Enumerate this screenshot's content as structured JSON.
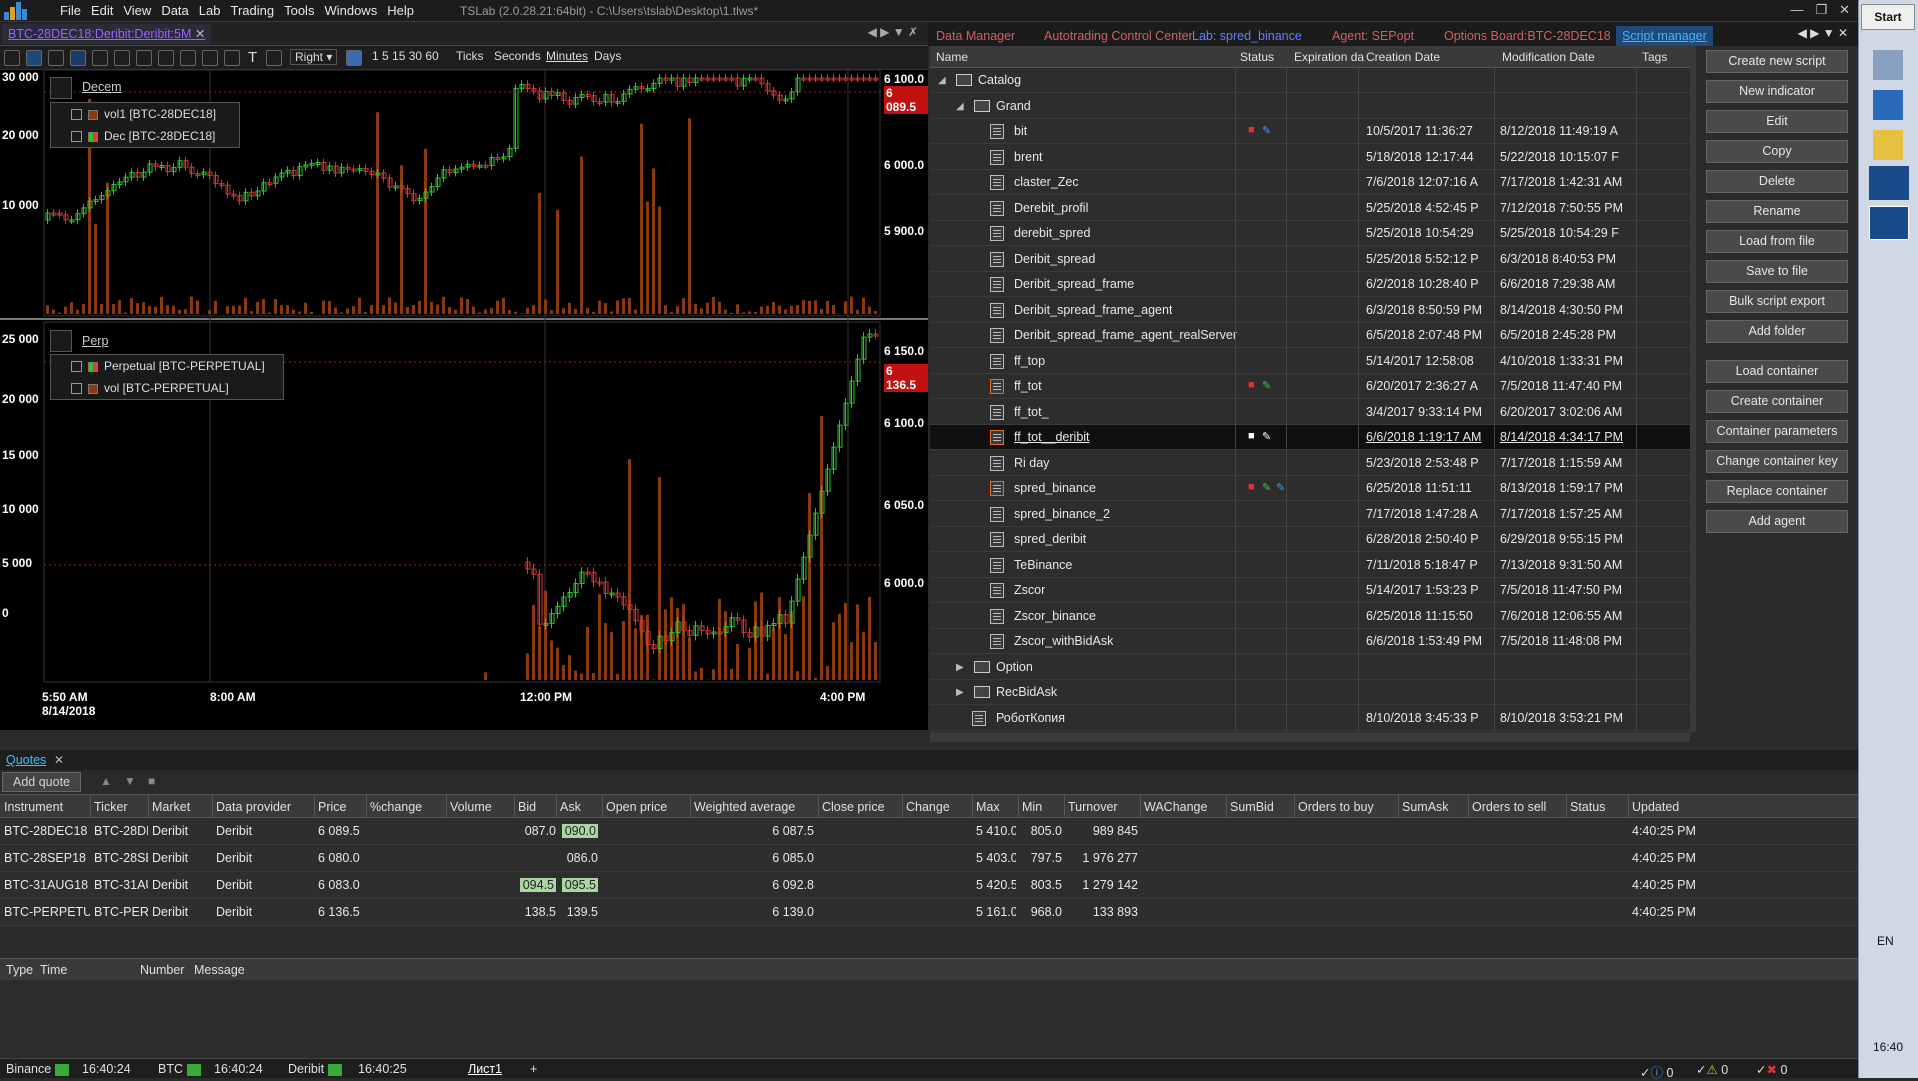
{
  "app": {
    "title": "TSLab (2.0.28.21:64bit) - C:\\Users\\tslab\\Desktop\\1.tlws*",
    "menu": [
      "File",
      "Edit",
      "View",
      "Data",
      "Lab",
      "Trading",
      "Tools",
      "Windows",
      "Help"
    ]
  },
  "chart_tab": {
    "label": "BTC-28DEC18:Deribit:Deribit:5M"
  },
  "toolbar": {
    "mode": "Right",
    "intervals": "1 5 15 30 60",
    "units": [
      "Ticks",
      "Seconds",
      "Minutes",
      "Days"
    ]
  },
  "charts": {
    "top": {
      "pane_name": "Decem",
      "legend": [
        "vol1 [BTC-28DEC18]",
        "Dec [BTC-28DEC18]"
      ],
      "left_axis": [
        "30 000",
        "20 000",
        "10 000"
      ],
      "right_axis": [
        "6 100.0",
        "6 000.0",
        "5 900.0"
      ],
      "last_price": "6 089.5"
    },
    "bottom": {
      "pane_name": "Perp",
      "legend": [
        "Perpetual [BTC-PERPETUAL]",
        "vol [BTC-PERPETUAL]"
      ],
      "left_axis": [
        "25 000",
        "20 000",
        "15 000",
        "10 000",
        "5 000",
        "0"
      ],
      "right_axis": [
        "6 150.0",
        "6 100.0",
        "6 050.0",
        "6 000.0"
      ],
      "last_price": "6 136.5"
    },
    "time_axis": [
      "5:50 AM",
      "8:00 AM",
      "12:00 PM",
      "4:00 PM"
    ],
    "date": "8/14/2018"
  },
  "colors": {
    "up": "#22cc22",
    "down": "#e03030",
    "volume": "#8b3a10",
    "accent": "#1e90ff"
  },
  "right_tabs": [
    {
      "label": "Data Manager",
      "color": "#d06060"
    },
    {
      "label": "Autotrading Control Center",
      "color": "#d06060"
    },
    {
      "label": "Lab: spred_binance",
      "color": "#6080ff"
    },
    {
      "label": "Agent: SEPopt",
      "color": "#d06060"
    },
    {
      "label": "Options Board:BTC-28DEC18",
      "color": "#d06060"
    },
    {
      "label": "Script manager",
      "color": "#1e90ff"
    }
  ],
  "tree_columns": [
    "Name",
    "Status",
    "Expiration da",
    "Creation Date",
    "Modification Date",
    "Tags"
  ],
  "tree": [
    {
      "name": "Catalog",
      "level": 0,
      "type": "folder",
      "created": "",
      "modified": ""
    },
    {
      "name": "Grand",
      "level": 1,
      "type": "folder",
      "created": "",
      "modified": ""
    },
    {
      "name": "bit",
      "level": 2,
      "type": "file",
      "status": "lock-red pencil-blue",
      "created": "10/5/2017 11:36:27",
      "modified": "8/12/2018 11:49:19 A"
    },
    {
      "name": "brent",
      "level": 2,
      "type": "file",
      "created": "5/18/2018 12:17:44",
      "modified": "5/22/2018 10:15:07 F"
    },
    {
      "name": "claster_Zec",
      "level": 2,
      "type": "file",
      "created": "7/6/2018 12:07:16 A",
      "modified": "7/17/2018 1:42:31 AM"
    },
    {
      "name": "Derebit_profil",
      "level": 2,
      "type": "file",
      "created": "5/25/2018 4:52:45 P",
      "modified": "7/12/2018 7:50:55 PM"
    },
    {
      "name": "derebit_spred",
      "level": 2,
      "type": "file",
      "created": "5/25/2018 10:54:29",
      "modified": "5/25/2018 10:54:29 F"
    },
    {
      "name": "Deribit_spread",
      "level": 2,
      "type": "file",
      "created": "5/25/2018 5:52:12 P",
      "modified": "6/3/2018 8:40:53 PM"
    },
    {
      "name": "Deribit_spread_frame",
      "level": 2,
      "type": "file",
      "created": "6/2/2018 10:28:40 P",
      "modified": "6/6/2018 7:29:38 AM"
    },
    {
      "name": "Deribit_spread_frame_agent",
      "level": 2,
      "type": "file",
      "created": "6/3/2018 8:50:59 PM",
      "modified": "8/14/2018 4:30:50 PM"
    },
    {
      "name": "Deribit_spread_frame_agent_realServer",
      "level": 2,
      "type": "file",
      "created": "6/5/2018 2:07:48 PM",
      "modified": "6/5/2018 2:45:28 PM"
    },
    {
      "name": "ff_top",
      "level": 2,
      "type": "file",
      "created": "5/14/2017 12:58:08",
      "modified": "4/10/2018 1:33:31 PM"
    },
    {
      "name": "ff_tot",
      "level": 2,
      "type": "file-agent",
      "status": "lock-red pencil-green",
      "created": "6/20/2017 2:36:27 A",
      "modified": "7/5/2018 11:47:40 PM"
    },
    {
      "name": "ff_tot_",
      "level": 2,
      "type": "file",
      "created": "3/4/2017 9:33:14 PM",
      "modified": "6/20/2017 3:02:06 AM"
    },
    {
      "name": "ff_tot__deribit",
      "level": 2,
      "type": "file-agent",
      "status": "lock-white pencil-white",
      "created": "6/6/2018 1:19:17 AM",
      "modified": "8/14/2018 4:34:17 PM",
      "selected": true
    },
    {
      "name": "Ri day",
      "level": 2,
      "type": "file",
      "created": "5/23/2018 2:53:48 P",
      "modified": "7/17/2018 1:15:59 AM"
    },
    {
      "name": "spred_binance",
      "level": 2,
      "type": "file-agent",
      "status": "lock-red pencil-green pencil-blue",
      "created": "6/25/2018 11:51:11",
      "modified": "8/13/2018 1:59:17 PM"
    },
    {
      "name": "spred_binance_2",
      "level": 2,
      "type": "file",
      "created": "7/17/2018 1:47:28 A",
      "modified": "7/17/2018 1:57:25 AM"
    },
    {
      "name": "spred_deribit",
      "level": 2,
      "type": "file",
      "created": "6/28/2018 2:50:40 P",
      "modified": "6/29/2018 9:55:15 PM"
    },
    {
      "name": "TeBinance",
      "level": 2,
      "type": "file",
      "created": "7/11/2018 5:18:47 P",
      "modified": "7/13/2018 9:31:50 AM"
    },
    {
      "name": "Zscor",
      "level": 2,
      "type": "file",
      "created": "5/14/2017 1:53:23 P",
      "modified": "7/5/2018 11:47:50 PM"
    },
    {
      "name": "Zscor_binance",
      "level": 2,
      "type": "file",
      "created": "6/25/2018 11:15:50",
      "modified": "7/6/2018 12:06:55 AM"
    },
    {
      "name": "Zscor_withBidAsk",
      "level": 2,
      "type": "file",
      "created": "6/6/2018 1:53:49 PM",
      "modified": "7/5/2018 11:48:08 PM"
    },
    {
      "name": "Option",
      "level": 1,
      "type": "folder-collapsed",
      "created": "",
      "modified": ""
    },
    {
      "name": "RecBidAsk",
      "level": 1,
      "type": "folder-collapsed",
      "created": "",
      "modified": ""
    },
    {
      "name": "РоботКопия",
      "level": 1,
      "type": "file",
      "created": "8/10/2018 3:45:33 P",
      "modified": "8/10/2018 3:53:21 PM"
    }
  ],
  "side_buttons": [
    "Create new script",
    "New indicator",
    "Edit",
    "Copy",
    "Delete",
    "Rename",
    "Load from file",
    "Save to file",
    "Bulk script export",
    "Add folder",
    "Load container",
    "Create container",
    "Container parameters",
    "Change container key",
    "Replace container",
    "Add agent"
  ],
  "quotes": {
    "tab": "Quotes",
    "add_button": "Add quote",
    "columns": [
      "Instrument",
      "Ticker",
      "Market",
      "Data provider",
      "Price",
      "%change",
      "Volume",
      "Bid",
      "Ask",
      "Open price",
      "Weighted average",
      "Close price",
      "Change",
      "Max",
      "Min",
      "Turnover",
      "WAChange",
      "SumBid",
      "Orders to buy",
      "SumAsk",
      "Orders to sell",
      "Status",
      "Updated"
    ],
    "rows": [
      {
        "instrument": "BTC-28DEC18",
        "ticker": "BTC-28DE",
        "market": "Deribit",
        "provider": "Deribit",
        "price": "6 089.5",
        "bid": "087.0",
        "ask": "090.0",
        "ask_hl": true,
        "bid_hl": false,
        "wavg": "6 087.5",
        "max": "5 410.0",
        "min": "805.0",
        "turnover": "989 845",
        "updated": "4:40:25 PM"
      },
      {
        "instrument": "BTC-28SEP18",
        "ticker": "BTC-28SE",
        "market": "Deribit",
        "provider": "Deribit",
        "price": "6 080.0",
        "bid": "",
        "ask": "086.0",
        "ask_hl": false,
        "bid_hl": true,
        "wavg": "6 085.0",
        "max": "5 403.0",
        "min": "797.5",
        "turnover": "1 976 277",
        "updated": "4:40:25 PM"
      },
      {
        "instrument": "BTC-31AUG18",
        "ticker": "BTC-31AU",
        "market": "Deribit",
        "provider": "Deribit",
        "price": "6 083.0",
        "bid": "094.5",
        "ask": "095.5",
        "ask_hl": true,
        "bid_hl": true,
        "wavg": "6 092.8",
        "max": "5 420.5",
        "min": "803.5",
        "turnover": "1 279 142",
        "updated": "4:40:25 PM"
      },
      {
        "instrument": "BTC-PERPETUAL",
        "ticker": "BTC-PERF",
        "market": "Deribit",
        "provider": "Deribit",
        "price": "6 136.5",
        "bid": "138.5",
        "ask": "139.5",
        "ask_hl": false,
        "bid_hl": false,
        "wavg": "6 139.0",
        "max": "5 161.0",
        "min": "968.0",
        "turnover": "133 893",
        "updated": "4:40:25 PM"
      }
    ]
  },
  "log_columns": [
    "Type",
    "Time",
    "Number",
    "Message"
  ],
  "status_bar": {
    "items": [
      {
        "name": "Binance",
        "time": "16:40:24"
      },
      {
        "name": "BTC",
        "time": "16:40:24"
      },
      {
        "name": "Deribit",
        "time": "16:40:25"
      }
    ],
    "sheet": "Лист1",
    "counts": [
      "0",
      "0",
      "0"
    ]
  },
  "taskbar": {
    "start": "Start",
    "lang": "EN",
    "time": "16:40"
  }
}
